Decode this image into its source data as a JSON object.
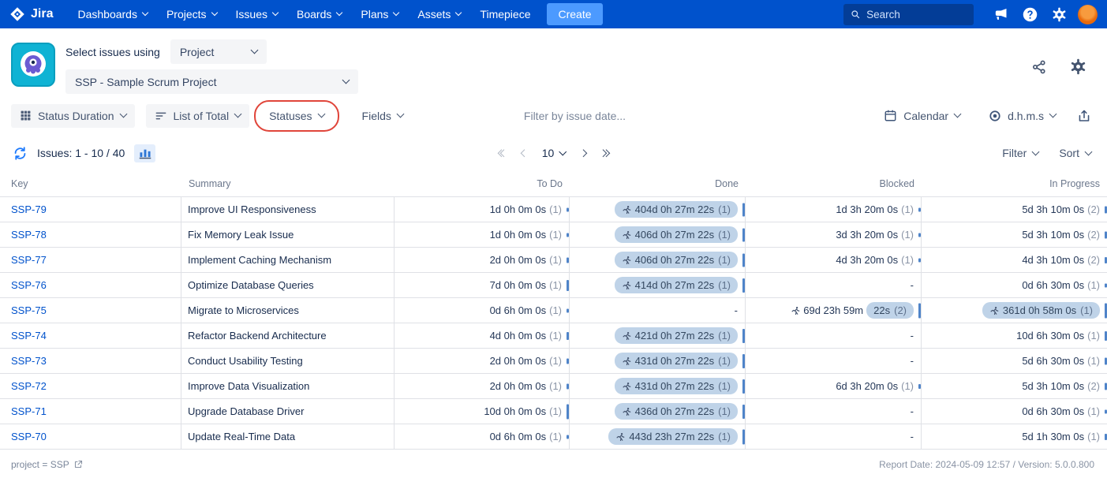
{
  "colors": {
    "nav_bg": "#0052CC",
    "create_bg": "#4C9AFF",
    "link_blue": "#0052CC",
    "pill_bg": "#BFD3E8",
    "annotation_red": "#E0453A",
    "bar_blue": "#4F84C9"
  },
  "nav": {
    "brand": "Jira",
    "items": [
      {
        "label": "Dashboards",
        "chevron": true
      },
      {
        "label": "Projects",
        "chevron": true
      },
      {
        "label": "Issues",
        "chevron": true
      },
      {
        "label": "Boards",
        "chevron": true
      },
      {
        "label": "Plans",
        "chevron": true
      },
      {
        "label": "Assets",
        "chevron": true
      },
      {
        "label": "Timepiece",
        "chevron": false
      }
    ],
    "create_label": "Create",
    "search_placeholder": "Search"
  },
  "header": {
    "select_issues_label": "Select issues using",
    "issue_source_value": "Project",
    "project_value": "SSP - Sample Scrum Project"
  },
  "toolbar": {
    "report_type_label": "Status Duration",
    "list_mode_label": "List of Total",
    "statuses_label": "Statuses",
    "fields_label": "Fields",
    "date_filter_placeholder": "Filter by issue date...",
    "calendar_label": "Calendar",
    "duration_format_label": "d.h.m.s",
    "annotation": {
      "shape": "red-oval",
      "target": "statuses",
      "color": "#E0453A"
    }
  },
  "pagination": {
    "issues_range_label": "Issues: 1 - 10 / 40",
    "page_size_value": "10",
    "filter_label": "Filter",
    "sort_label": "Sort"
  },
  "table": {
    "columns": [
      "Key",
      "Summary",
      "To Do",
      "Done",
      "Blocked",
      "In Progress"
    ],
    "rows": [
      {
        "key": "SSP-79",
        "summary": "Improve UI Responsiveness",
        "todo": {
          "text": "1d 0h 0m 0s",
          "count": "(1)",
          "bar": 0.08
        },
        "done": {
          "pill": "404d 0h 27m 22s",
          "count": "(1)",
          "runner": "pill",
          "bar": 0.88
        },
        "blocked": {
          "text": "1d 3h 20m 0s",
          "count": "(1)",
          "bar": 0.04
        },
        "inprogress": {
          "text": "5d 3h 10m 0s",
          "count": "(2)",
          "bar": 0.3
        }
      },
      {
        "key": "SSP-78",
        "summary": "Fix Memory Leak Issue",
        "todo": {
          "text": "1d 0h 0m 0s",
          "count": "(1)",
          "bar": 0.08
        },
        "done": {
          "pill": "406d 0h 27m 22s",
          "count": "(1)",
          "runner": "pill",
          "bar": 0.89
        },
        "blocked": {
          "text": "3d 3h 20m 0s",
          "count": "(1)",
          "bar": 0.06
        },
        "inprogress": {
          "text": "5d 3h 10m 0s",
          "count": "(2)",
          "bar": 0.3
        }
      },
      {
        "key": "SSP-77",
        "summary": "Implement Caching Mechanism",
        "todo": {
          "text": "2d 0h 0m 0s",
          "count": "(1)",
          "bar": 0.18
        },
        "done": {
          "pill": "406d 0h 27m 22s",
          "count": "(1)",
          "runner": "pill",
          "bar": 0.89
        },
        "blocked": {
          "text": "4d 3h 20m 0s",
          "count": "(1)",
          "bar": 0.07
        },
        "inprogress": {
          "text": "4d 3h 10m 0s",
          "count": "(2)",
          "bar": 0.26
        }
      },
      {
        "key": "SSP-76",
        "summary": "Optimize Database Queries",
        "todo": {
          "text": "7d 0h 0m 0s",
          "count": "(1)",
          "bar": 0.68
        },
        "done": {
          "pill": "414d 0h 27m 22s",
          "count": "(1)",
          "runner": "pill",
          "bar": 0.91
        },
        "blocked": {
          "text": "-"
        },
        "inprogress": {
          "text": "0d 6h 30m 0s",
          "count": "(1)",
          "bar": 0.06
        }
      },
      {
        "key": "SSP-75",
        "summary": "Migrate to Microservices",
        "todo": {
          "text": "0d 6h 0m 0s",
          "count": "(1)",
          "bar": 0.04
        },
        "done": {
          "text": "-"
        },
        "blocked": {
          "runner": "plain",
          "text": "69d 23h 59m",
          "pill": "22s",
          "count": "(2)",
          "bar": 1
        },
        "inprogress": {
          "pill": "361d 0h 58m 0s",
          "count": "(1)",
          "runner": "pill",
          "bar": 1
        }
      },
      {
        "key": "SSP-74",
        "summary": "Refactor Backend Architecture",
        "todo": {
          "text": "4d 0h 0m 0s",
          "count": "(1)",
          "bar": 0.38
        },
        "done": {
          "pill": "421d 0h 27m 22s",
          "count": "(1)",
          "runner": "pill",
          "bar": 0.93
        },
        "blocked": {
          "text": "-"
        },
        "inprogress": {
          "text": "10d 6h 30m 0s",
          "count": "(1)",
          "bar": 0.52
        }
      },
      {
        "key": "SSP-73",
        "summary": "Conduct Usability Testing",
        "todo": {
          "text": "2d 0h 0m 0s",
          "count": "(1)",
          "bar": 0.18
        },
        "done": {
          "pill": "431d 0h 27m 22s",
          "count": "(1)",
          "runner": "pill",
          "bar": 0.95
        },
        "blocked": {
          "text": "-"
        },
        "inprogress": {
          "text": "5d 6h 30m 0s",
          "count": "(1)",
          "bar": 0.33
        }
      },
      {
        "key": "SSP-72",
        "summary": "Improve Data Visualization",
        "todo": {
          "text": "2d 0h 0m 0s",
          "count": "(1)",
          "bar": 0.18
        },
        "done": {
          "pill": "431d 0h 27m 22s",
          "count": "(1)",
          "runner": "pill",
          "bar": 0.95
        },
        "blocked": {
          "text": "6d 3h 20m 0s",
          "count": "(1)",
          "bar": 0.1
        },
        "inprogress": {
          "text": "5d 3h 10m 0s",
          "count": "(2)",
          "bar": 0.3
        }
      },
      {
        "key": "SSP-71",
        "summary": "Upgrade Database Driver",
        "todo": {
          "text": "10d 0h 0m 0s",
          "count": "(1)",
          "bar": 1
        },
        "done": {
          "pill": "436d 0h 27m 22s",
          "count": "(1)",
          "runner": "pill",
          "bar": 0.96
        },
        "blocked": {
          "text": "-"
        },
        "inprogress": {
          "text": "0d 6h 30m 0s",
          "count": "(1)",
          "bar": 0.06
        }
      },
      {
        "key": "SSP-70",
        "summary": "Update Real-Time Data",
        "todo": {
          "text": "0d 6h 0m 0s",
          "count": "(1)",
          "bar": 0.04
        },
        "done": {
          "pill": "443d 23h 27m 22s",
          "count": "(1)",
          "runner": "pill",
          "bar": 1
        },
        "blocked": {
          "text": "-"
        },
        "inprogress": {
          "text": "5d 1h 30m 0s",
          "count": "(1)",
          "bar": 0.29
        }
      }
    ]
  },
  "footer": {
    "query_text": "project = SSP",
    "report_info": "Report Date: 2024-05-09 12:57 / Version: 5.0.0.800"
  }
}
